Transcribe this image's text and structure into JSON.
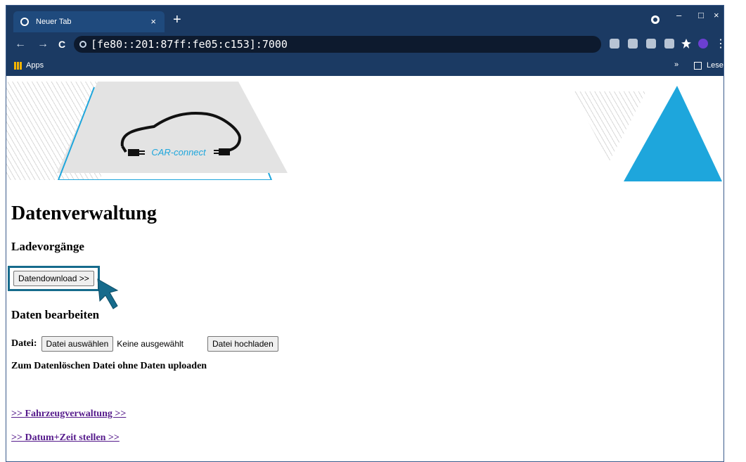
{
  "browser": {
    "tab_title": "Neuer Tab",
    "tab_close": "×",
    "new_tab": "+",
    "url": "[fe80::201:87ff:fe05:c153]:7000",
    "bookmarks": {
      "apps_label": "Apps",
      "more": "»",
      "reading_list": "Leseliste"
    },
    "window_controls": {
      "minimize": "–",
      "maximize": "□",
      "close": "×"
    },
    "nav": {
      "back": "←",
      "forward": "→",
      "reload": "C"
    },
    "menu": "⋮"
  },
  "logo": {
    "text": "CAR-connect",
    "accent": "#1ea6dc"
  },
  "page": {
    "title": "Datenverwaltung",
    "section_charging": "Ladevorgänge",
    "download_button": "Datendownload >>",
    "section_edit": "Daten bearbeiten",
    "file_label": "Datei:",
    "choose_file_button": "Datei auswählen",
    "no_file": "Keine ausgewählt",
    "upload_button": "Datei hochladen",
    "delete_note": "Zum Datenlöschen Datei ohne Daten uploaden",
    "link_vehicle": ">> Fahrzeugverwaltung >>",
    "link_datetime": ">> Datum+Zeit stellen >>"
  },
  "colors": {
    "highlight_box": "#166b8c",
    "triangle": "#1ea6dc",
    "chrome": "#1b3a63"
  }
}
